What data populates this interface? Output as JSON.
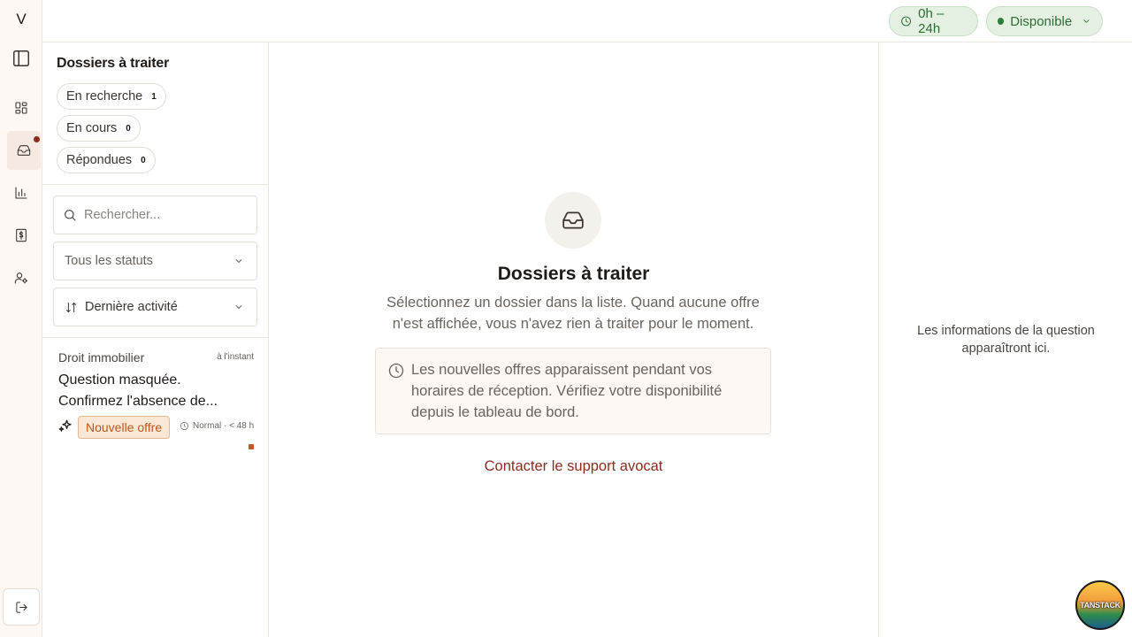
{
  "rail": {
    "logo": "V",
    "items": [
      {
        "name": "sidebar-toggle-icon"
      },
      {
        "name": "dashboard-icon"
      },
      {
        "name": "inbox-icon",
        "active": true,
        "notification": true
      },
      {
        "name": "stats-icon"
      },
      {
        "name": "billing-icon"
      },
      {
        "name": "profile-icon"
      }
    ],
    "logout_icon": "logout-icon"
  },
  "topbar": {
    "hours_label": "0h – 24h",
    "availability_label": "Disponible"
  },
  "list": {
    "title": "Dossiers à traiter",
    "filters": [
      {
        "label": "En recherche",
        "count": "1"
      },
      {
        "label": "En cours",
        "count": "0"
      },
      {
        "label": "Répondues",
        "count": "0"
      }
    ],
    "search_placeholder": "Rechercher...",
    "status_select": "Tous les statuts",
    "sort_select": "Dernière activité",
    "cards": [
      {
        "category": "Droit immobilier",
        "time": "à l'instant",
        "question": "Question masquée. Confirmez l'absence de...",
        "tag": "Nouvelle offre",
        "priority": "Normal · < 48 h"
      }
    ]
  },
  "center": {
    "title": "Dossiers à traiter",
    "description": "Sélectionnez un dossier dans la liste. Quand aucune offre n'est affichée, vous n'avez rien à traiter pour le moment.",
    "note": "Les nouvelles offres apparaissent pendant vos horaires de réception. Vérifiez votre disponibilité depuis le tableau de bord.",
    "support_link": "Contacter le support avocat"
  },
  "right": {
    "placeholder": "Les informations de la question apparaîtront ici."
  },
  "badge": {
    "text": "TANSTACK"
  },
  "colors": {
    "accent": "#8a2c1e",
    "available_bg": "#e4f1e2",
    "available_text": "#2f6b36",
    "new_offer_bg": "#fbe7d6",
    "new_offer_text": "#b85a1b"
  }
}
